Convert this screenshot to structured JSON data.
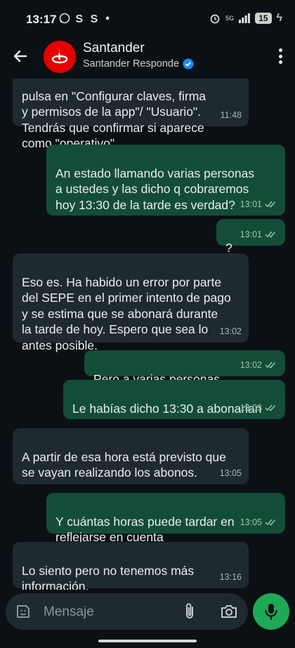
{
  "status_bar": {
    "time": "13:17",
    "notifications": "S S",
    "network": "5G",
    "battery": "15"
  },
  "header": {
    "title": "Santander",
    "subtitle": "Santander Responde"
  },
  "messages": [
    {
      "dir": "in",
      "text": "pulsa en \"Configurar claves, firma\ny permisos de la app\"/ \"Usuario\".\nTendrás que confirmar si aparece\ncomo \"operativo\".",
      "time": "11:48"
    },
    {
      "dir": "out",
      "text": "An estado llamando varias personas\na ustedes y las dicho q cobraremos\nhoy 13:30 de la tarde es verdad?",
      "time": "13:01"
    },
    {
      "dir": "out",
      "text": "?",
      "time": "13:01"
    },
    {
      "dir": "in",
      "text": "Eso es. Ha habido un error por parte\ndel SEPE en el primer intento de pago\ny se estima que se abonará durante\nla tarde de hoy. Espero que sea lo\nantes posible.",
      "time": "13:02"
    },
    {
      "dir": "out",
      "text": "Pero a varias personas",
      "time": "13:02"
    },
    {
      "dir": "out",
      "text": "Le habías dicho 13:30 a abonarian",
      "time": "13:03"
    },
    {
      "dir": "in",
      "text": "A partir de esa hora está previsto que\nse vayan realizando los abonos.",
      "time": "13:05"
    },
    {
      "dir": "out",
      "text": "Y cuántas horas puede tardar en\nreflejarse en cuenta",
      "time": "13:05"
    },
    {
      "dir": "in",
      "text": "Lo siento pero no tenemos más\ninformación.",
      "time": "13:16"
    }
  ],
  "composer": {
    "placeholder": "Mensaje"
  },
  "colors": {
    "background": "#0b1014",
    "incoming_bubble": "#1f2a30",
    "outgoing_bubble": "#134d37",
    "brand_red": "#e60000",
    "mic_green": "#1fa855",
    "verified_blue": "#1a8cff"
  }
}
